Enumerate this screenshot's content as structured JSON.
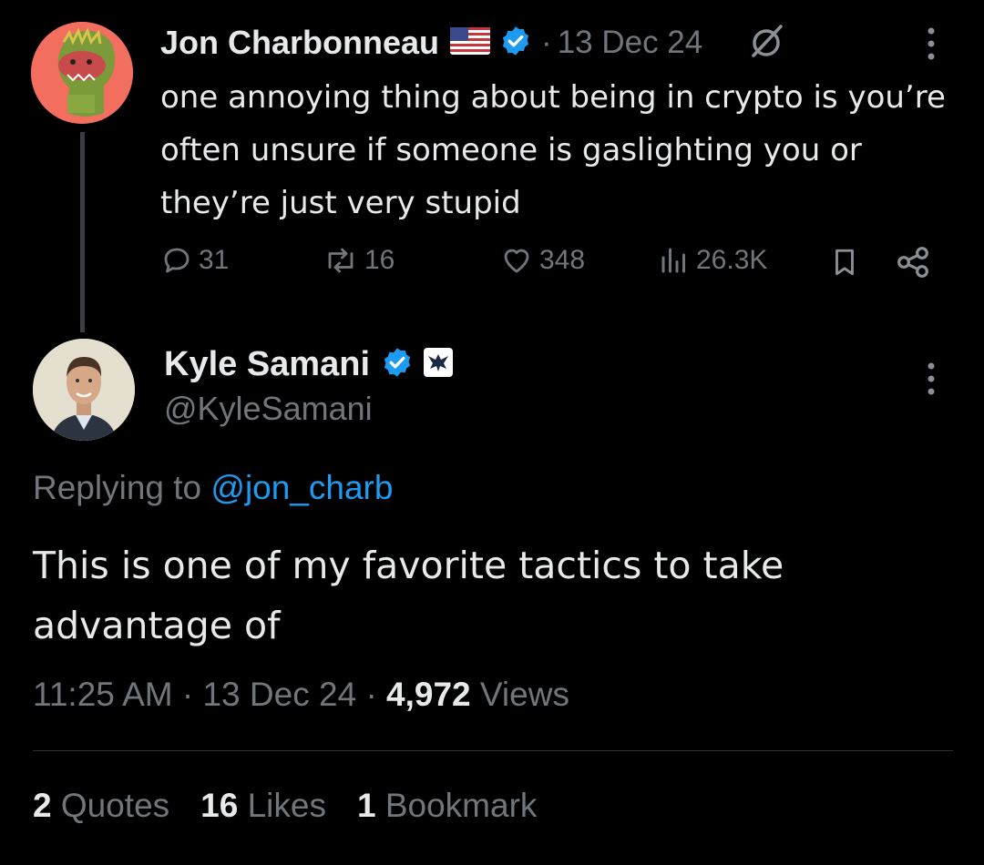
{
  "original_tweet": {
    "author_name": "Jon Charbonneau",
    "flag_icon": "us-flag-icon",
    "verified": true,
    "separator": "·",
    "date": "13 Dec 24",
    "text": "one annoying thing about being in crypto is you’re often unsure if someone is gaslighting you or they’re just very stupid",
    "actions": {
      "replies": "31",
      "reposts": "16",
      "likes": "348",
      "views": "26.3K"
    }
  },
  "reply_tweet": {
    "author_name": "Kyle Samani",
    "verified": true,
    "affiliate_badge": "phoenix-badge-icon",
    "handle": "@KyleSamani",
    "replying_prefix": "Replying to",
    "replying_handle": "@jon_charb",
    "text": "This is one of my favorite tactics to take advantage of",
    "time": "11:25 AM",
    "sep1": "·",
    "date": "13 Dec 24",
    "sep2": "·",
    "views_count": "4,972",
    "views_label": "Views"
  },
  "engagement": {
    "quotes_count": "2",
    "quotes_label": "Quotes",
    "likes_count": "16",
    "likes_label": "Likes",
    "bookmarks_count": "1",
    "bookmarks_label": "Bookmark"
  },
  "colors": {
    "background": "#000000",
    "text": "#e7e9ea",
    "muted": "#71767b",
    "link": "#1d9bf0",
    "verified": "#1d9bf0"
  }
}
